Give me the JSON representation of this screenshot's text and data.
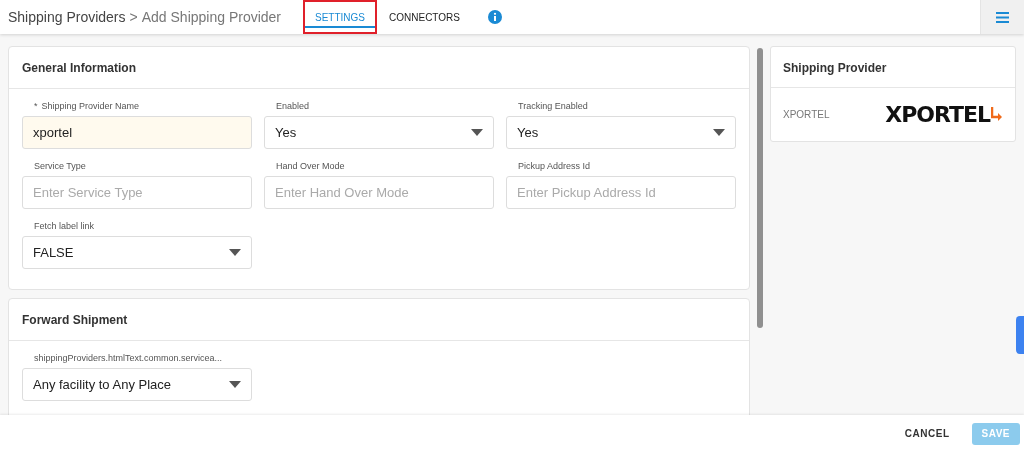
{
  "breadcrumb": {
    "parent": "Shipping Providers",
    "separator": ">",
    "current": "Add Shipping Provider"
  },
  "tabs": [
    {
      "label": "SETTINGS",
      "selected": true,
      "highlighted": true
    },
    {
      "label": "CONNECTORS",
      "selected": false,
      "highlighted": false
    }
  ],
  "sections": [
    {
      "title": "General Information",
      "fields": [
        {
          "kind": "text",
          "label": "Shipping Provider Name",
          "required_mark": "*",
          "value": "xportel"
        },
        {
          "kind": "select",
          "label": "Enabled",
          "value": "Yes"
        },
        {
          "kind": "select",
          "label": "Tracking Enabled",
          "value": "Yes"
        },
        {
          "kind": "text",
          "label": "Service Type",
          "placeholder": "Enter Service Type"
        },
        {
          "kind": "text",
          "label": "Hand Over Mode",
          "placeholder": "Enter Hand Over Mode"
        },
        {
          "kind": "text",
          "label": "Pickup Address Id",
          "placeholder": "Enter Pickup Address Id"
        },
        {
          "kind": "select",
          "label": "Fetch label link",
          "value": "FALSE"
        }
      ]
    },
    {
      "title": "Forward Shipment",
      "fields": [
        {
          "kind": "select",
          "label": "shippingProviders.htmlText.common.servicea...",
          "value": "Any facility to Any Place"
        }
      ]
    }
  ],
  "provider_card": {
    "title": "Shipping Provider",
    "name": "XPORTEL",
    "logo": "XPORTEL"
  },
  "footer": {
    "buttons": [
      {
        "kind": "text",
        "label": "CANCEL",
        "disabled": false
      },
      {
        "kind": "primary",
        "label": "SAVE",
        "disabled": true
      }
    ]
  }
}
